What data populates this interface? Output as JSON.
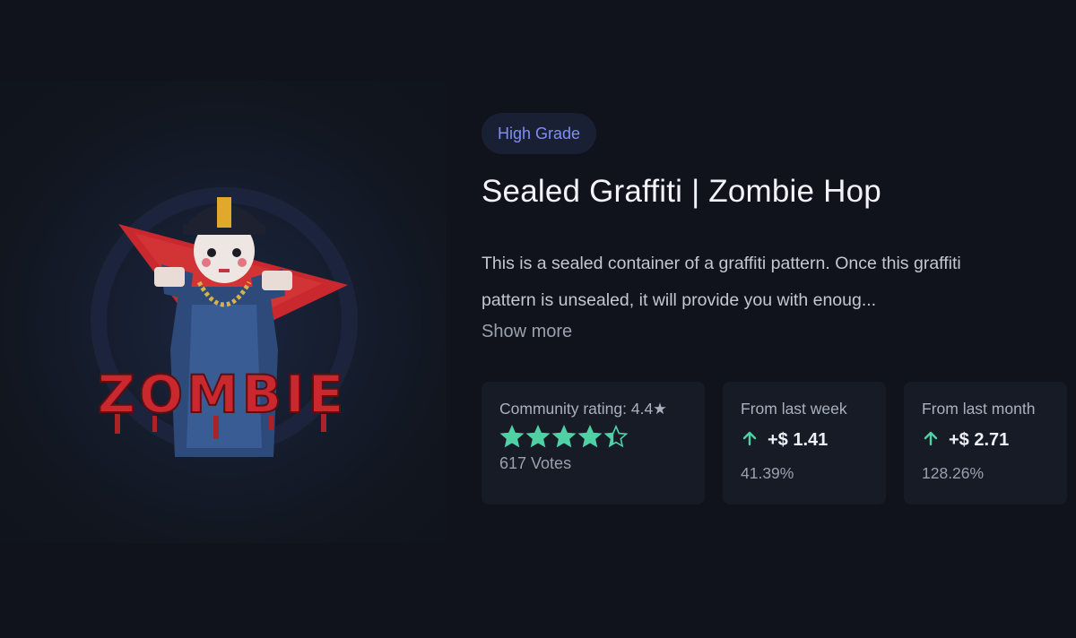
{
  "item": {
    "grade": "High Grade",
    "title": "Sealed Graffiti | Zombie Hop",
    "description": "This is a sealed container of a graffiti pattern. Once this graffiti pattern is unsealed, it will provide you with enoug...",
    "show_more_label": "Show more",
    "image_text": "ZOMBIE"
  },
  "rating": {
    "label": "Community rating: 4.4★",
    "value": 4.4,
    "max": 5,
    "votes": "617 Votes"
  },
  "week": {
    "label": "From last week",
    "change": "+$ 1.41",
    "percent": "41.39%",
    "icon": "arrow-up-icon"
  },
  "month": {
    "label": "From last month",
    "change": "+$ 2.71",
    "percent": "128.26%",
    "icon": "arrow-up-icon"
  },
  "colors": {
    "accent": "#7f8ef5",
    "positive": "#4fd1a5",
    "star": "#4fd1a5",
    "background": "#10131c",
    "card": "#161b26"
  }
}
